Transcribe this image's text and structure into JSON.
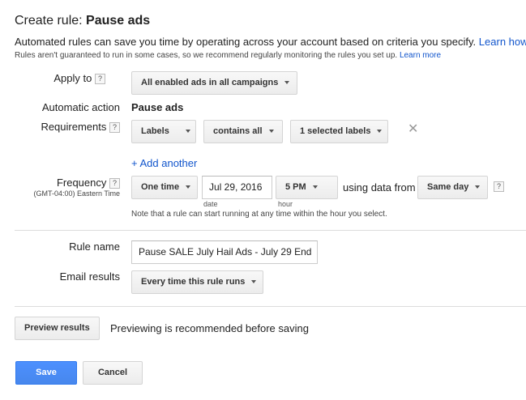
{
  "header": {
    "title_prefix": "Create rule: ",
    "title_name": "Pause ads",
    "intro": "Automated rules can save you time by operating across your account based on criteria you specify.",
    "intro_link": "Learn how",
    "note": "Rules aren't guaranteed to run in some cases, so we recommend regularly monitoring the rules you set up.",
    "note_link": "Learn more"
  },
  "apply_to": {
    "label": "Apply to",
    "help": "?",
    "value": "All enabled ads in all campaigns"
  },
  "automatic_action": {
    "label": "Automatic action",
    "value": "Pause ads"
  },
  "requirements": {
    "label": "Requirements",
    "help": "?",
    "field": "Labels",
    "operator": "contains all",
    "value": "1 selected labels",
    "remove": "✕",
    "add_link": "+ Add another"
  },
  "frequency": {
    "label": "Frequency",
    "help": "?",
    "timezone": "(GMT-04:00) Eastern Time",
    "value": "One time",
    "date": "Jul 29, 2016",
    "date_sub": "date",
    "hour": "5 PM",
    "hour_sub": "hour",
    "using_data_from": "using data from",
    "data_range": "Same day",
    "help2": "?",
    "note": "Note that a rule can start running at any time within the hour you select."
  },
  "rule_name": {
    "label": "Rule name",
    "value": "Pause SALE July Hail Ads - July 29 End"
  },
  "email_results": {
    "label": "Email results",
    "value": "Every time this rule runs"
  },
  "preview": {
    "button": "Preview results",
    "text": "Previewing is recommended before saving"
  },
  "actions": {
    "save": "Save",
    "cancel": "Cancel"
  },
  "colors": {
    "link": "#1155cc",
    "primary": "#4d90fe"
  }
}
